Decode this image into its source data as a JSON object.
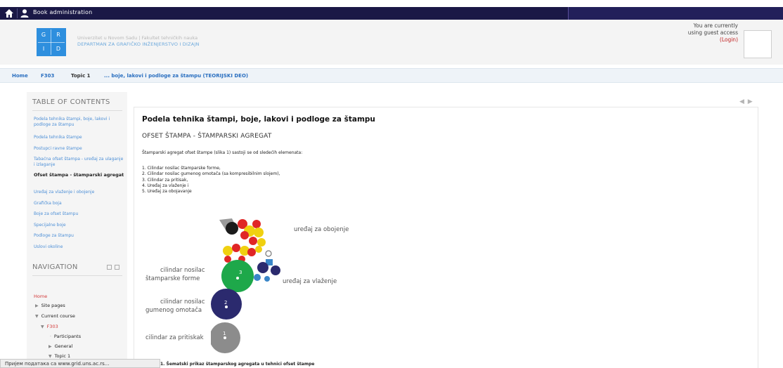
{
  "topbar": {
    "title": "Book administration",
    "icons": [
      "home-icon",
      "user-icon"
    ]
  },
  "header": {
    "logo_letters": [
      "G",
      "R",
      "I",
      "D"
    ],
    "university_line": "Univerzitet u Novom Sadu  |  Fakultet tehničkih nauka",
    "department_line": "DEPARTMAN ZA GRAFIČKO INŽENJERSTVO I DIZAJN",
    "guest_line1": "You are currently",
    "guest_line2": "using guest access",
    "login_label": "(Login)"
  },
  "breadcrumb": {
    "items": [
      "Home",
      "F303",
      "Topic 1",
      "... boje, lakovi i podloge za štampu (TEORIJSKI DEO)"
    ]
  },
  "toc": {
    "title": "TABLE OF CONTENTS",
    "items": [
      "Podela tehnika štampi, boje, lakovi i podloge za štampu",
      "Podela tehnika štampe",
      "Postupci ravne štampe",
      "Tabaćna ofset štampa - uređaj za ulaganje i izlaganje",
      "Ofset štampa - štamparski agregat",
      "Uređaj za vlaženje i obojenje",
      "Grafička boja",
      "Boje za ofset štampu",
      "Specijalne boje",
      "Podloge za štampu",
      "Uslovi okoline"
    ]
  },
  "navigation": {
    "title": "NAVIGATION",
    "home": "Home",
    "site_pages": "Site pages",
    "current_course": "Current course",
    "course": "F303",
    "participants": "Participants",
    "general": "General",
    "topic": "Topic 1"
  },
  "content": {
    "pager": "◀ ▶",
    "title": "Podela tehnika štampi, boje, lakovi i podloge za štampu",
    "subtitle": "OFSET ŠTAMPA - ŠTAMPARSKI AGREGAT",
    "intro": "Štamparski agregat ofset štampe (slika 1) sastoji se od sledećih elemenata:",
    "list": [
      "1. Cilindar nosilac štamparske forme,",
      "2. Cilindar nosilac gumenog omotača (sa kompresibilnim slojem),",
      "3. Cilindar za pritisak,",
      "4. Uređaj za vlaženje i",
      "5. Uređaj za obojavanje"
    ],
    "diagram": {
      "inking": "uređaj za obojenje",
      "dampening": "uređaj za vlaženje",
      "plate_1": "cilindar nosilac",
      "plate_2": "štamparske forme",
      "blanket_1": "cilindar nosilac",
      "blanket_2": "gumenog omotača",
      "impression": "cilindar za pritiskak",
      "numbers": [
        "3",
        "2",
        "1"
      ]
    },
    "caption": "1. Šematski prikaz štamparskog agregata u tehnici ofset štampe"
  },
  "statusbar": {
    "text": "Пријем података са www.grid.uns.ac.rs..."
  },
  "colors": {
    "topbar": "#1a1846",
    "logo": "#2e8fde",
    "link": "#4d8fd6",
    "login": "#c02020",
    "plate_cylinder": "#1ea84a",
    "blanket_cylinder": "#2b2a6e",
    "impression_cylinder": "#8c8c8c"
  }
}
